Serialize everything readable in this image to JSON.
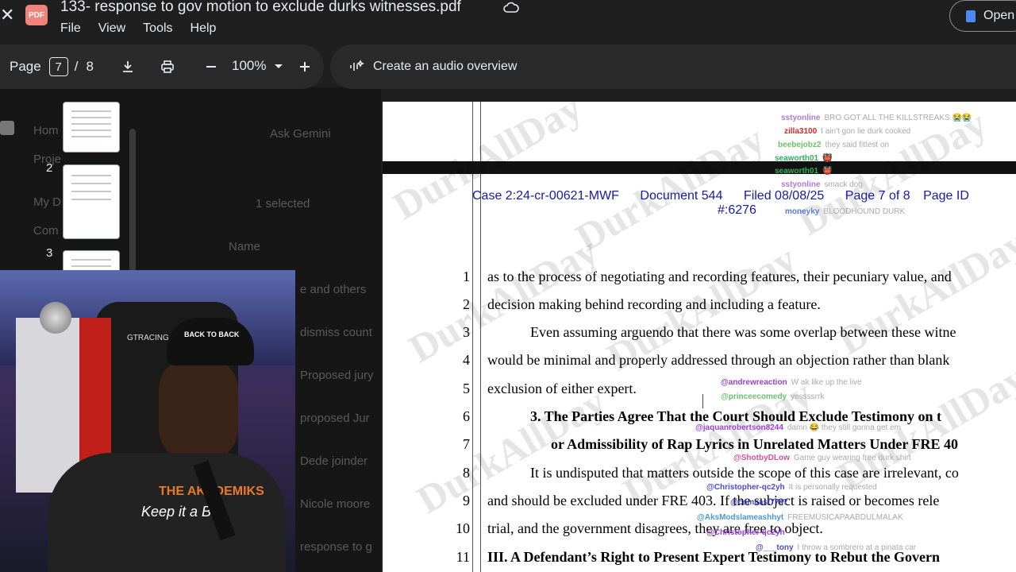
{
  "window": {
    "title": "133- response to gov motion to exclude durks witnesses.pdf",
    "badge": "PDF",
    "menu": [
      "File",
      "View",
      "Tools",
      "Help"
    ],
    "open_label": "Open"
  },
  "toolbar": {
    "page_label": "Page",
    "current_page": "7",
    "separator": "/",
    "total_pages": "8",
    "zoom": "100%",
    "audio_label": "Create an audio overview"
  },
  "thumbnails": [
    "2",
    "3"
  ],
  "background_drive": {
    "ask_gemini": "Ask Gemini",
    "selected": "1 selected",
    "name_col": "Name",
    "files": [
      "e and others",
      "dismiss count",
      "Proposed jury",
      "proposed Jur",
      "Dede joinder",
      "Nicole moore",
      "response to g"
    ],
    "sidebar": [
      "Hom",
      "Proje",
      "My D",
      "Com"
    ]
  },
  "webcam": {
    "hat_text": "BACK TO BACK",
    "shirt_text": "THE AKADEMIKS",
    "shirt_script": "Keep it a Be",
    "chair_brand": "GTRACING"
  },
  "pdf": {
    "header_case": "Case 2:24-cr-00621-MWF",
    "header_doc": "Document 544",
    "header_filed": "Filed 08/08/25",
    "header_page": "Page 7 of 8",
    "header_pageid": "Page ID",
    "header_id": "#:6276",
    "watermark": "DurkAllDay",
    "lines": [
      {
        "n": "1",
        "text": "as to the process of negotiating and recording features, their pecuniary value, and"
      },
      {
        "n": "2",
        "text": "decision making behind recording and including a feature."
      },
      {
        "n": "3",
        "text": "Even assuming arguendo that there was some overlap between these witne"
      },
      {
        "n": "4",
        "text": "would be minimal and properly addressed through an objection rather than blank"
      },
      {
        "n": "5",
        "text": "exclusion of either expert."
      },
      {
        "n": "6",
        "text": "3.  The Parties Agree That the Court Should Exclude Testimony on t"
      },
      {
        "n": "7",
        "text": "or Admissibility of Rap Lyrics in Unrelated Matters Under FRE 40"
      },
      {
        "n": "8",
        "text": "It is undisputed that matters outside the scope of this case are irrelevant, co"
      },
      {
        "n": "9",
        "text": "and should be excluded under FRE 403. If the subject is raised or becomes rele"
      },
      {
        "n": "10",
        "text": "trial, and the government disagrees, they are free to object."
      },
      {
        "n": "11",
        "text": "III.   A Defendant’s Right to Present Expert Testimony to Rebut the Govern"
      }
    ]
  },
  "chat_top": [
    {
      "user": "sstyonline",
      "msg": "BRO GOT ALL THE KILLSTREAKS 😭😭",
      "color": "#b07ad6"
    },
    {
      "user": "zilla3100",
      "msg": "I ain't gon lie durk cooked",
      "color": "#d22a2a"
    },
    {
      "user": "beebejobz2",
      "msg": "they said fittest on",
      "color": "#6ac36a"
    },
    {
      "user": "seaworth01",
      "msg": "👹",
      "color": "#2fb05a"
    },
    {
      "user": "seaworth01",
      "msg": "👹",
      "color": "#2fb05a"
    },
    {
      "user": "sstyonline",
      "msg": "smack dog",
      "color": "#b07ad6"
    },
    {
      "user": "moneyky",
      "msg": "BLOODHOUND DURK",
      "color": "#5a7ad6"
    }
  ],
  "chat_bottom": [
    {
      "user": "@andrewreaction",
      "msg": "W ak like up the live",
      "color": "#9b3fd6"
    },
    {
      "user": "@princeecomedy",
      "msg": "yessssrrk",
      "color": "#6ac36a"
    },
    {
      "user": "@jaquanrobertson8244",
      "msg": "damn 😂 they still gonna get em",
      "color": "#9b3fd6"
    },
    {
      "user": "@ShotbyDLow",
      "msg": "Game guy wearing free durk shirt",
      "color": "#d64fa0"
    },
    {
      "user": "@Christopher-qc2yh",
      "msg": "It is personally requested",
      "color": "#4a4ad6"
    },
    {
      "user": "@comcast7747",
      "msg": "",
      "color": "#4a4ad6"
    },
    {
      "user": "@AksModslameashhyt",
      "msg": "FREEMUSICAPAABDULMALAK",
      "color": "#4a9ad6"
    },
    {
      "user": "@Christopher-qc2yh",
      "msg": "",
      "color": "#9b3fd6"
    },
    {
      "user": "@___tony",
      "msg": "I throw a sombrero at a pinata car",
      "color": "#4a4ad6"
    }
  ]
}
